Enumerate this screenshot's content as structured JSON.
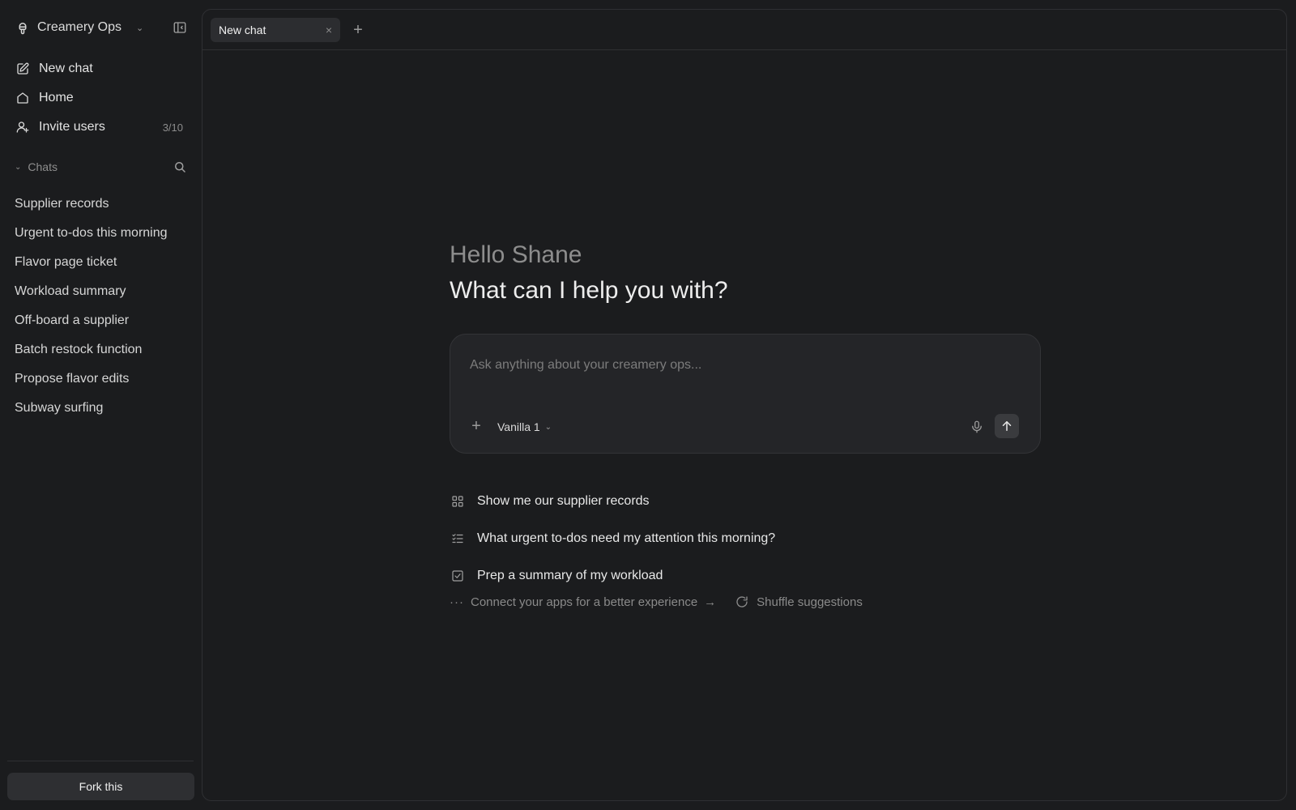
{
  "sidebar": {
    "workspace": {
      "name": "Creamery Ops",
      "icon": "ice-cream-icon"
    },
    "nav": [
      {
        "label": "New chat",
        "icon": "edit-icon"
      },
      {
        "label": "Home",
        "icon": "home-icon"
      },
      {
        "label": "Invite users",
        "icon": "user-plus-icon",
        "count": "3/10"
      }
    ],
    "chats_label": "Chats",
    "chats": [
      "Supplier records",
      "Urgent to-dos this morning",
      "Flavor page ticket",
      "Workload summary",
      "Off-board a supplier",
      "Batch restock function",
      "Propose flavor edits",
      "Subway surfing"
    ],
    "fork_label": "Fork this"
  },
  "tabs": [
    {
      "label": "New chat",
      "active": true
    }
  ],
  "main": {
    "greeting": "Hello Shane",
    "question": "What can I help you with?",
    "composer": {
      "placeholder": "Ask anything about your creamery ops...",
      "model": "Vanilla 1"
    },
    "suggestions": [
      {
        "icon": "grid-icon",
        "label": "Show me our supplier records"
      },
      {
        "icon": "checklist-icon",
        "label": "What urgent to-dos need my attention this morning?"
      },
      {
        "icon": "checkbox-icon",
        "label": "Prep a summary of my workload"
      }
    ],
    "connect_label": "Connect your apps for a better experience",
    "shuffle_label": "Shuffle suggestions"
  },
  "colors": {
    "background": "#1b1c1e",
    "surface": "#242528",
    "tab_active": "#2c2d30",
    "button": "#2e2f32",
    "muted_text": "#8d8d8d"
  }
}
